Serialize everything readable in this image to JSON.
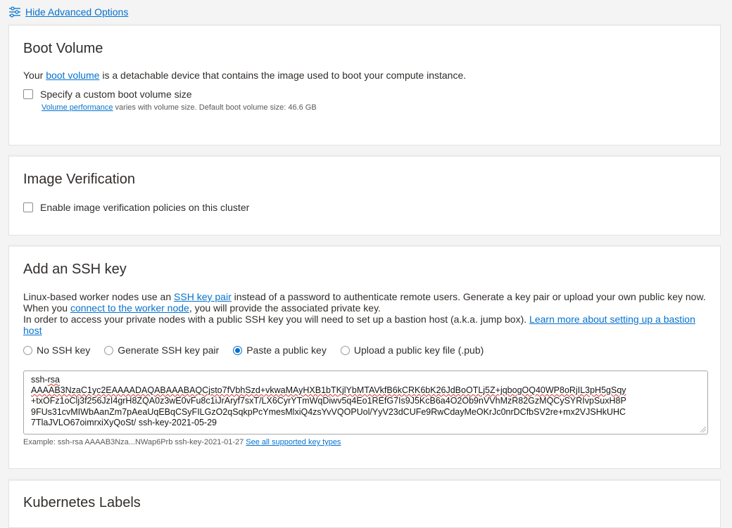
{
  "top": {
    "advanced_toggle": "Hide Advanced Options",
    "icon": "sliders-icon"
  },
  "boot_volume": {
    "title": "Boot Volume",
    "desc_prefix": "Your ",
    "desc_link": "boot volume",
    "desc_suffix": " is a detachable device that contains the image used to boot your compute instance.",
    "checkbox_label": "Specify a custom boot volume size",
    "checkbox_checked": false,
    "hint_link": "Volume performance",
    "hint_text": " varies with volume size. Default boot volume size: 46.6 GB"
  },
  "image_verification": {
    "title": "Image Verification",
    "checkbox_label": "Enable image verification policies on this cluster",
    "checkbox_checked": false
  },
  "ssh": {
    "title": "Add an SSH key",
    "line1_prefix": "Linux-based worker nodes use an ",
    "line1_link": "SSH key pair",
    "line1_suffix": " instead of a password to authenticate remote users. Generate a key pair or upload your own public key now.",
    "line2_prefix": "When you ",
    "line2_link": "connect to the worker node",
    "line2_suffix": ", you will provide the associated private key.",
    "line3_prefix": "In order to access your private nodes with a public SSH key you will need to set up a bastion host (a.k.a. jump box). ",
    "line3_link_a": "Learn more about setting up a bastion",
    "line3_link_b": "host",
    "options": [
      "No SSH key",
      "Generate SSH key pair",
      "Paste a public key",
      "Upload a public key file (.pub)"
    ],
    "selected_option": "Paste a public key",
    "key_value_line1": "ssh-rsa",
    "key_value_line2": "AAAAB3NzaC1yc2EAAAADAQABAAABAQCjsto7fVbhSzd+vkwaMAyHXB1bTKjlYbMTAVkfB6kCRK6bK26JdBoOTLj5Z+jqbogOQ40WP8oRjIL3pH5gSqy",
    "key_value_line3": "+txOFz1oClj3f256JzI4grH8ZQA0z3wE0vFu8c1iJrAryf7sxT/LX6CyrYTmWqDiwv5q4Eo1REfG7Is9J5KcB6a4O2Ob9nVVhMzR82GzMQCySYRIvpSuxH8P",
    "key_value_line4": "9FUs31cvMIWbAanZm7pAeaUqEBqCSyFILGzO2qSqkpPcYmesMlxiQ4zsYvVQOPUol/YyV23dCUFe9RwCdayMeOKrJc0nrDCfbSV2re+mx2VJSHkUHC",
    "key_value_line5": "7TlaJVLO67oimrxiXyQoSt/ ssh-key-2021-05-29",
    "example_text": "Example: ssh-rsa AAAAB3Nza...NWap6Prb ssh-key-2021-01-27 ",
    "example_link": "See all supported key types"
  },
  "kubernetes_labels": {
    "title": "Kubernetes Labels"
  }
}
